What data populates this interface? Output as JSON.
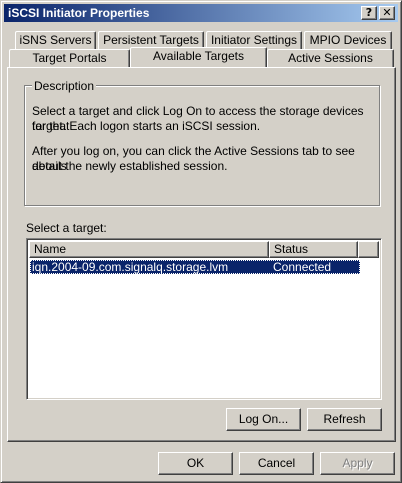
{
  "window": {
    "title": "iSCSI Initiator Properties",
    "help_glyph": "?",
    "close_glyph": "✕"
  },
  "tabs": {
    "back_row": [
      "iSNS Servers",
      "Persistent Targets",
      "Initiator Settings",
      "MPIO Devices"
    ],
    "front_row": [
      "Target Portals",
      "Available Targets",
      "Active Sessions"
    ],
    "active": "Available Targets"
  },
  "description": {
    "heading": "Description",
    "paragraph1_line1": "Select a target and click Log On to access the storage devices for that",
    "paragraph1_line2": "target. Each logon starts an iSCSI session.",
    "paragraph2_line1": "After you log on, you can click the Active Sessions tab to see details",
    "paragraph2_line2": "about the newly established session."
  },
  "targets": {
    "label": "Select a target:",
    "columns": [
      "Name",
      "Status"
    ],
    "rows": [
      {
        "name": "iqn.2004-09.com.signalq.storage.lvm",
        "status": "Connected",
        "selected": true
      }
    ]
  },
  "panel_buttons": {
    "logon": "Log On...",
    "refresh": "Refresh"
  },
  "dialog_buttons": {
    "ok": "OK",
    "cancel": "Cancel",
    "apply": "Apply",
    "apply_enabled": false
  },
  "colors": {
    "face": "#d4d0c8",
    "titlebar_start": "#0a246a",
    "titlebar_end": "#a6caf0",
    "selection": "#0a246a"
  }
}
